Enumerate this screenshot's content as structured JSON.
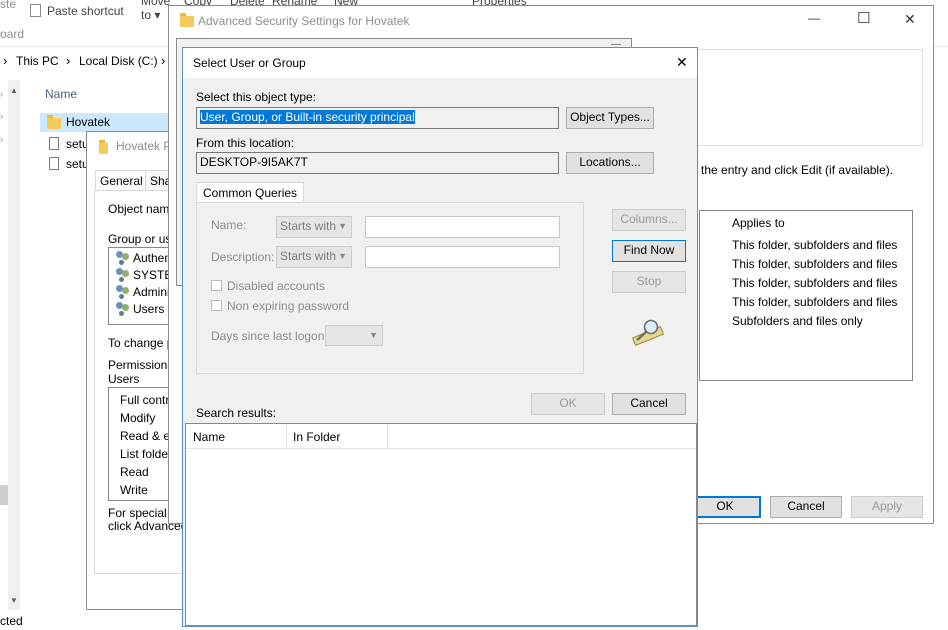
{
  "explorer": {
    "ribbon": {
      "paste_shortcut": "Paste shortcut",
      "move_to": "Move\nto",
      "copy": "Copy",
      "delete": "Delete",
      "rename": "Rename",
      "new": "New",
      "properties": "Properties",
      "clipboard": "oard",
      "paste_top": "ste"
    },
    "breadcrumb": [
      "This PC",
      "Local Disk (C:)"
    ],
    "column_name": "Name",
    "files": [
      "Hovatek",
      "setu",
      "setu"
    ],
    "status": "cted"
  },
  "properties_dialog": {
    "title": "Hovatek P",
    "tabs": [
      "General",
      "Sha"
    ],
    "object_name_label": "Object name",
    "group_label": "Group or use",
    "groups": [
      "Authent",
      "SYSTE",
      "Adminis",
      "Users (D"
    ],
    "change_label": "To change p",
    "permissions_label": "Permissions f",
    "permissions_for": "Users",
    "permissions": [
      "Full contro",
      "Modify",
      "Read & ex",
      "List folder",
      "Read",
      "Write"
    ],
    "special_label": "For special p",
    "special_label2": "click Advanced"
  },
  "advanced_security": {
    "title": "Advanced Security Settings for Hovatek",
    "instruction": "the entry and click Edit (if available).",
    "applies_to_header": "Applies to",
    "applies_to": [
      "This folder, subfolders and files",
      "This folder, subfolders and files",
      "This folder, subfolders and files",
      "This folder, subfolders and files",
      "Subfolders and files only"
    ],
    "ok": "OK",
    "cancel": "Cancel",
    "apply": "Apply"
  },
  "select_dialog": {
    "title": "Select User or Group",
    "object_type_label": "Select this object type:",
    "object_type_value": "User, Group, or Built-in security principal",
    "object_types_button": "Object Types...",
    "location_label": "From this location:",
    "location_value": "DESKTOP-9I5AK7T",
    "locations_button": "Locations...",
    "tab_common_queries": "Common Queries",
    "name_label": "Name:",
    "name_mode": "Starts with",
    "description_label": "Description:",
    "description_mode": "Starts with",
    "disabled_accounts": "Disabled accounts",
    "non_expiring": "Non expiring password",
    "days_label": "Days since last logon:",
    "columns_button": "Columns...",
    "find_now_button": "Find Now",
    "stop_button": "Stop",
    "ok_button": "OK",
    "cancel_button": "Cancel",
    "search_results_label": "Search results:",
    "result_columns": [
      "Name",
      "In Folder"
    ]
  },
  "icons": {
    "close": "✕",
    "minimize": "—",
    "maximize": "☐",
    "chevron": "›",
    "dropdown": "▼"
  }
}
